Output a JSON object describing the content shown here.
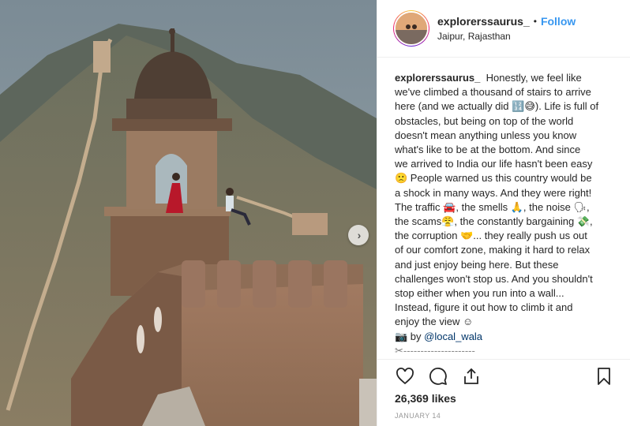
{
  "post": {
    "username": "explorerssaurus_",
    "separator": "•",
    "follow_label": "Follow",
    "location": "Jaipur, Rajasthan",
    "caption_lines": [
      "Honestly, we feel like",
      "we've climbed a thousand of stairs to arrive",
      "here (and we actually did 🔢😅). Life is full of",
      "obstacles, but being on top of the world",
      "doesn't mean anything unless you know",
      "what's like to be at the bottom. And since",
      "we arrived to India our life hasn't been easy",
      "🙁 People warned us this country would be",
      "a shock in many ways. And they were right!",
      "The traffic 🚘, the smells 🙏, the noise 🗣,",
      "the scams😤, the constantly bargaining 💸,",
      "the corruption 🤝... they really push us out",
      "of our comfort zone, making it hard to relax",
      "and just enjoy being here. But these",
      "challenges won't stop us. And you shouldn't",
      "stop either when you run into a wall...",
      "Instead, figure it out how to climb it and",
      "enjoy the view ☺"
    ],
    "photo_credit_prefix": "📷 by ",
    "photo_credit_handle": "@local_wala",
    "scissor_line": "✂---------------------",
    "likes": "26,369 likes",
    "date": "JANUARY 14"
  },
  "icons": {
    "like": "heart-icon",
    "comment": "comment-icon",
    "share": "share-icon",
    "save": "bookmark-icon",
    "next": "chevron-right-icon"
  },
  "colors": {
    "link": "#3897f0",
    "text": "#262626",
    "muted": "#999999"
  }
}
